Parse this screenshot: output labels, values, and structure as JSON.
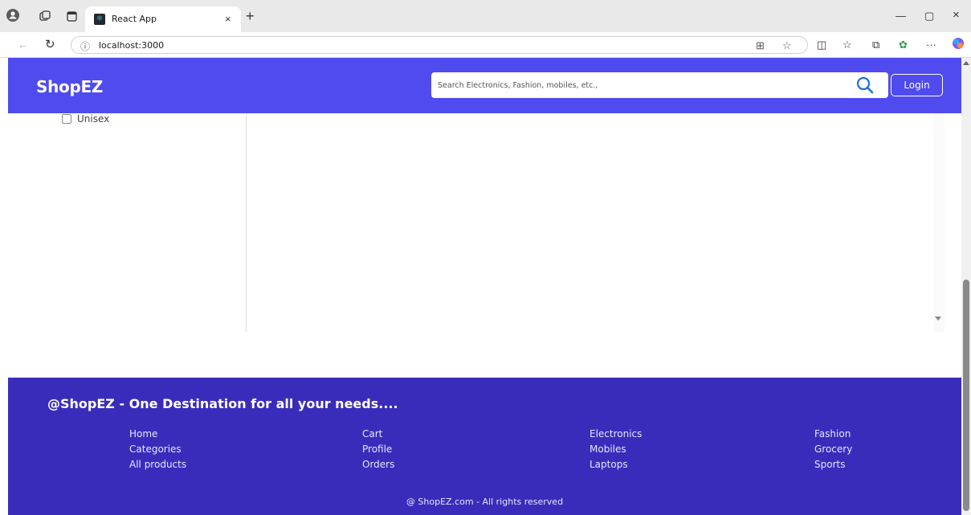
{
  "browser": {
    "tab_title": "React App",
    "url": "localhost:3000",
    "new_tab": "+",
    "tab_close": "×"
  },
  "navbar": {
    "brand": "ShopEZ",
    "search_placeholder": "Search Electronics, Fashion, mobiles, etc.,",
    "login_label": "Login"
  },
  "filters": {
    "options": [
      {
        "label": "Unisex",
        "checked": false
      }
    ]
  },
  "footer": {
    "tagline": "@ShopEZ - One Destination for all your needs....",
    "columns": [
      {
        "links": [
          "Home",
          "Categories",
          "All products"
        ]
      },
      {
        "links": [
          "Cart",
          "Profile",
          "Orders"
        ]
      },
      {
        "links": [
          "Electronics",
          "Mobiles",
          "Laptops"
        ]
      },
      {
        "links": [
          "Fashion",
          "Grocery",
          "Sports"
        ]
      }
    ],
    "copyright": "@ ShopEZ.com - All rights reserved"
  },
  "colors": {
    "navbar_bg": "#4f4bef",
    "footer_bg": "#3a2cbb",
    "search_icon": "#1e6fd9"
  },
  "icons": {
    "profile": "profile-icon",
    "workspaces": "workspaces-icon",
    "tab_actions": "tab-actions-icon",
    "back": "back-arrow-icon",
    "refresh": "refresh-icon",
    "info": "info-icon",
    "search": "search-icon"
  }
}
